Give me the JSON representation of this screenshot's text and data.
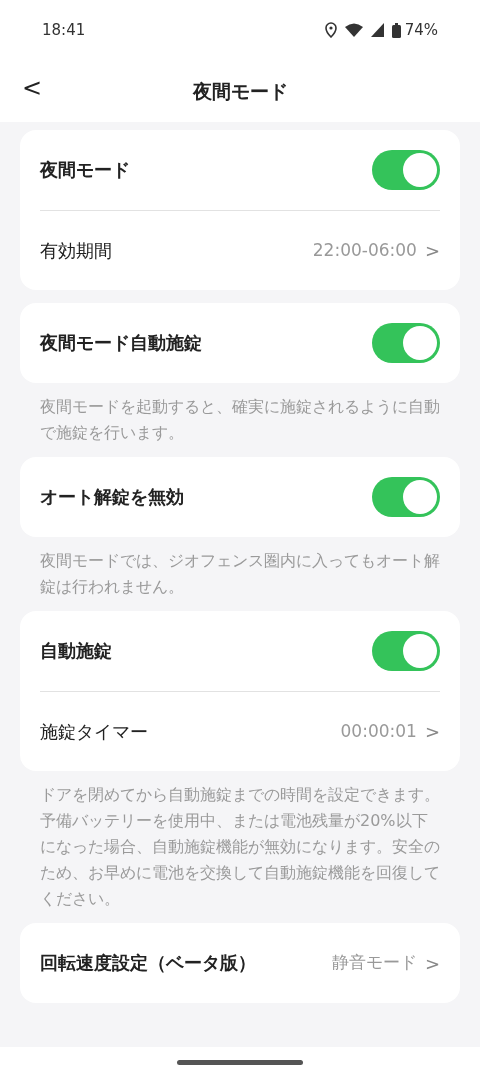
{
  "status_bar": {
    "time": "18:41",
    "battery": "74%"
  },
  "header": {
    "back": "<",
    "title": "夜間モード"
  },
  "sections": [
    {
      "rows": [
        {
          "kind": "toggle",
          "label": "夜間モード",
          "on": true
        },
        {
          "kind": "link",
          "label": "有効期間",
          "value": "22:00-06:00",
          "chevron": ">"
        }
      ]
    },
    {
      "rows": [
        {
          "kind": "toggle",
          "label": "夜間モード自動施錠",
          "on": true
        }
      ],
      "note": [
        "夜間モードを起動すると、確実に施錠されるように自動で施錠を行います。"
      ]
    },
    {
      "rows": [
        {
          "kind": "toggle",
          "label": "オート解錠を無効",
          "on": true
        }
      ],
      "note": [
        "夜間モードでは、ジオフェンス圏内に入ってもオート解錠は行われません。"
      ]
    },
    {
      "rows": [
        {
          "kind": "toggle",
          "label": "自動施錠",
          "on": true
        },
        {
          "kind": "link",
          "label": "施錠タイマー",
          "value": "00:00:01",
          "chevron": ">"
        }
      ],
      "note": [
        "ドアを閉めてから自動施錠までの時間を設定できます。",
        "予備バッテリーを使用中、または電池残量が20%以下になった場合、自動施錠機能が無効になります。安全のため、お早めに電池を交換して自動施錠機能を回復してください。"
      ]
    },
    {
      "rows": [
        {
          "kind": "link",
          "label": "回転速度設定（ベータ版）",
          "value": "静音モード",
          "chevron": ">"
        }
      ]
    }
  ]
}
